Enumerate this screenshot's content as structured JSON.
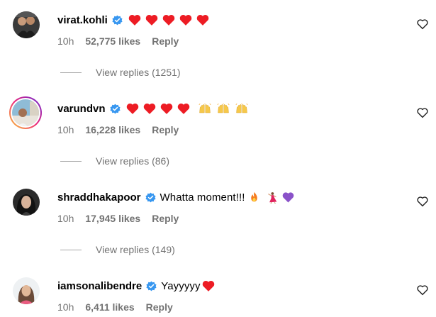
{
  "comments": [
    {
      "username": "virat.kohli",
      "verified": true,
      "text": "",
      "emojis": [
        "heart",
        "heart",
        "heart",
        "heart",
        "heart"
      ],
      "time": "10h",
      "likes": "52,775 likes",
      "reply_label": "Reply",
      "view_replies": "View replies (1251)"
    },
    {
      "username": "varundvn",
      "verified": true,
      "text": "",
      "emojis": [
        "heart",
        "heart",
        "heart",
        "heart",
        "raised-hands",
        "raised-hands",
        "raised-hands"
      ],
      "time": "10h",
      "likes": "16,228 likes",
      "reply_label": "Reply",
      "view_replies": "View replies (86)"
    },
    {
      "username": "shraddhakapoor",
      "verified": true,
      "text": "Whatta moment!!!",
      "emojis": [
        "fire",
        "dancer",
        "purple-heart"
      ],
      "time": "10h",
      "likes": "17,945 likes",
      "reply_label": "Reply",
      "view_replies": "View replies (149)"
    },
    {
      "username": "iamsonalibendre",
      "verified": true,
      "text": "Yayyyyy",
      "emojis": [
        "heart"
      ],
      "time": "10h",
      "likes": "6,411 likes",
      "reply_label": "Reply",
      "view_replies": ""
    }
  ],
  "colors": {
    "verified": "#3897f0",
    "heart": "#ed1c24",
    "meta_text": "#737373",
    "story_ring_start": "#f9ce34",
    "story_ring_mid": "#ee2a7b",
    "story_ring_end": "#6228d7"
  },
  "icons": {
    "like_button": "heart-outline-icon",
    "verified": "verified-badge-icon"
  }
}
